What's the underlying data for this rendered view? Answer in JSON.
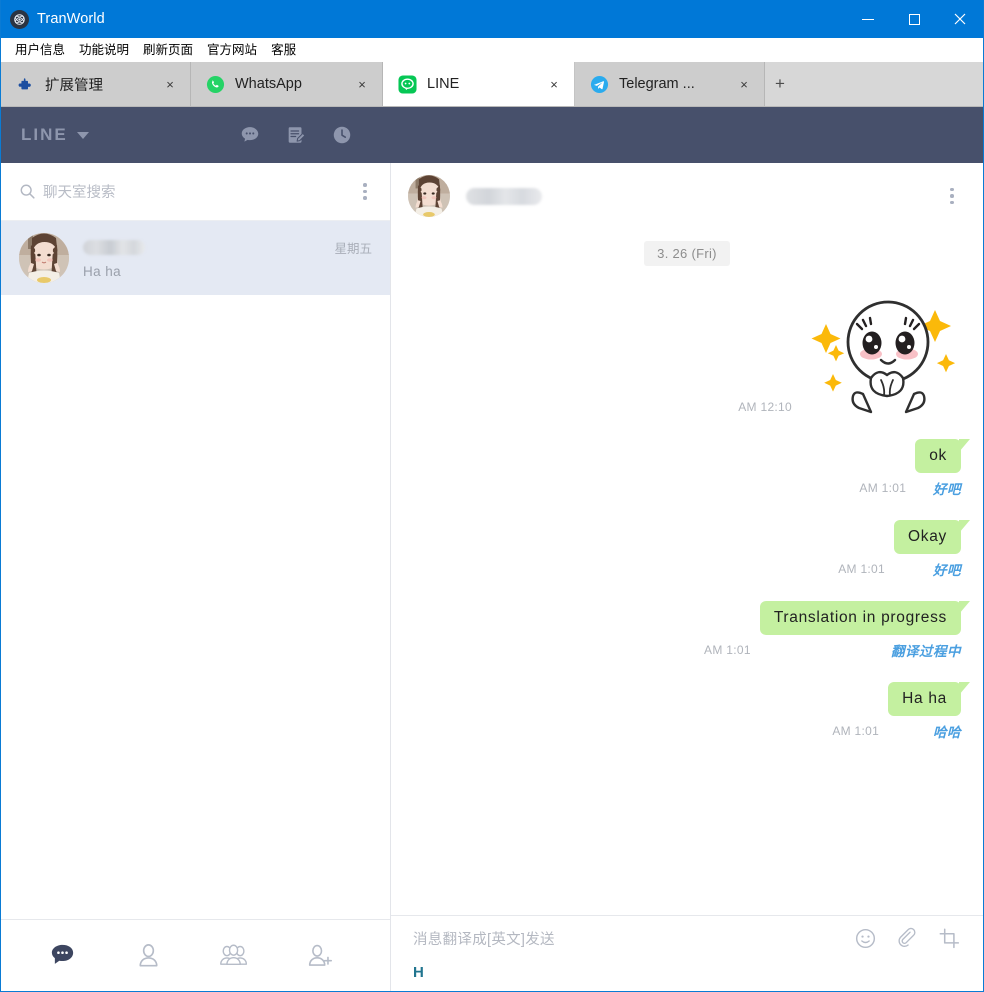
{
  "window": {
    "app_icon": "globe-atom-icon",
    "title": "TranWorld",
    "minimize_label": "Minimize",
    "maximize_label": "Maximize",
    "close_label": "Close"
  },
  "menubar": {
    "items": [
      {
        "label": "用户信息",
        "name": "menu-user-info"
      },
      {
        "label": "功能说明",
        "name": "menu-features"
      },
      {
        "label": "刷新页面",
        "name": "menu-refresh"
      },
      {
        "label": "官方网站",
        "name": "menu-official-site"
      },
      {
        "label": "客服",
        "name": "menu-support"
      }
    ]
  },
  "tabs": {
    "items": [
      {
        "label": "扩展管理",
        "icon": "puzzle-icon",
        "active": false,
        "close_label": "×"
      },
      {
        "label": "WhatsApp",
        "icon": "whatsapp-icon",
        "active": false,
        "close_label": "×"
      },
      {
        "label": "LINE",
        "icon": "line-icon",
        "active": true,
        "close_label": "×"
      },
      {
        "label": "Telegram ...",
        "icon": "telegram-icon",
        "active": false,
        "close_label": "×"
      }
    ],
    "new_tab_label": "+"
  },
  "line_header": {
    "logo": "LINE",
    "icons": [
      "chat-bubble-icon",
      "compose-note-icon",
      "clock-icon"
    ]
  },
  "sidebar": {
    "search": {
      "placeholder": "聊天室搜索",
      "icon": "search-icon"
    },
    "more_menu": "kebab-menu-icon",
    "chats": [
      {
        "name_redacted": true,
        "name_width": 62,
        "preview": "Ha  ha",
        "time": "星期五",
        "selected": true
      }
    ],
    "nav": [
      {
        "name": "nav-chats",
        "icon": "chat-filled-icon",
        "active": true
      },
      {
        "name": "nav-friends",
        "icon": "person-icon",
        "active": false
      },
      {
        "name": "nav-groups",
        "icon": "group-icon",
        "active": false
      },
      {
        "name": "nav-add-friend",
        "icon": "person-add-icon",
        "active": false
      }
    ]
  },
  "conversation": {
    "header": {
      "name_redacted": true,
      "more_menu": "kebab-menu-icon"
    },
    "date_divider": "3. 26 (Fri)",
    "sticker": {
      "time": "AM 12:10",
      "name": "sparkle-face-sticker"
    },
    "messages": [
      {
        "text": "ok",
        "time": "AM 1:01",
        "translation": "好吧",
        "outgoing": true
      },
      {
        "text": "Okay",
        "time": "AM 1:01",
        "translation": "好吧",
        "outgoing": true
      },
      {
        "text": "Translation in progress",
        "time": "AM 1:01",
        "translation": "翻译过程中",
        "outgoing": true
      },
      {
        "text": "Ha ha",
        "time": "AM 1:01",
        "translation": "哈哈",
        "outgoing": true
      }
    ]
  },
  "composer": {
    "placeholder": "消息翻译成[英文]发送",
    "typed_text": "H",
    "tools": [
      {
        "name": "emoji-icon",
        "label": "Emoji"
      },
      {
        "name": "attachment-icon",
        "label": "Attach file"
      },
      {
        "name": "screenshot-icon",
        "label": "Screenshot"
      }
    ]
  },
  "colors": {
    "titlebar": "#0078d7",
    "line_header": "#47506b",
    "bubble_green": "#c4f0a0",
    "translation_blue": "#4a9fe0",
    "selected_chat": "#e4e9f3",
    "typed_teal": "#21758f"
  }
}
